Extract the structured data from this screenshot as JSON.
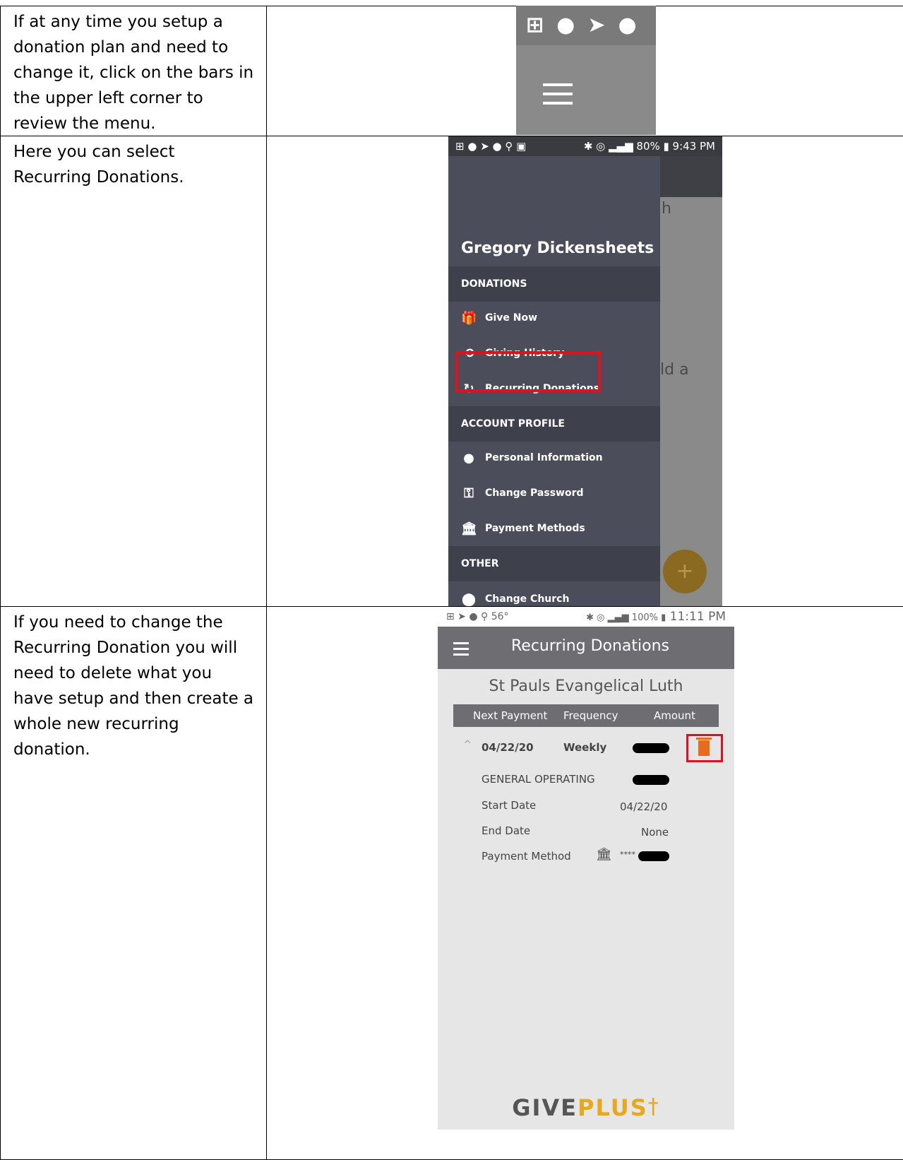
{
  "instructions": {
    "row1": "If at any time you setup a donation plan and need to change it, click on the bars in the upper left corner to review the menu.",
    "row2": "Here you can select Recurring Donations.",
    "row3": "If you need to change the Recurring Donation you will need to delete what you have setup and then create a whole new recurring donation."
  },
  "shot2": {
    "status_battery": "80%",
    "status_time": "9:43 PM",
    "bg_fragment_1": "h",
    "bg_fragment_2": "ld a",
    "user_name": "Gregory Dickensheets",
    "sections": {
      "donations": "DONATIONS",
      "account": "ACCOUNT PROFILE",
      "other": "OTHER"
    },
    "items": {
      "give_now": "Give Now",
      "giving_history": "Giving History",
      "recurring": "Recurring Donations",
      "personal": "Personal Information",
      "password": "Change Password",
      "payment": "Payment Methods",
      "church": "Change Church"
    },
    "fab": "+"
  },
  "shot3": {
    "status_temp": "56°",
    "status_battery": "100%",
    "status_time": "11:11 PM",
    "title": "Recurring Donations",
    "church": "St Pauls Evangelical Luth",
    "columns": [
      "Next Payment",
      "Frequency",
      "Amount"
    ],
    "row": {
      "next_payment": "04/22/20",
      "frequency": "Weekly"
    },
    "fund": "GENERAL OPERATING",
    "start_label": "Start Date",
    "start_value": "04/22/20",
    "end_label": "End Date",
    "end_value": "None",
    "method_label": "Payment Method",
    "method_mask": "****",
    "logo_give": "GIVE",
    "logo_plus": "PLUS",
    "logo_cross": "†"
  },
  "colors": {
    "drawer": "#4b4d5b",
    "highlight": "#e0111c",
    "trash": "#e86a1e",
    "logo_plus": "#e8a81e"
  }
}
